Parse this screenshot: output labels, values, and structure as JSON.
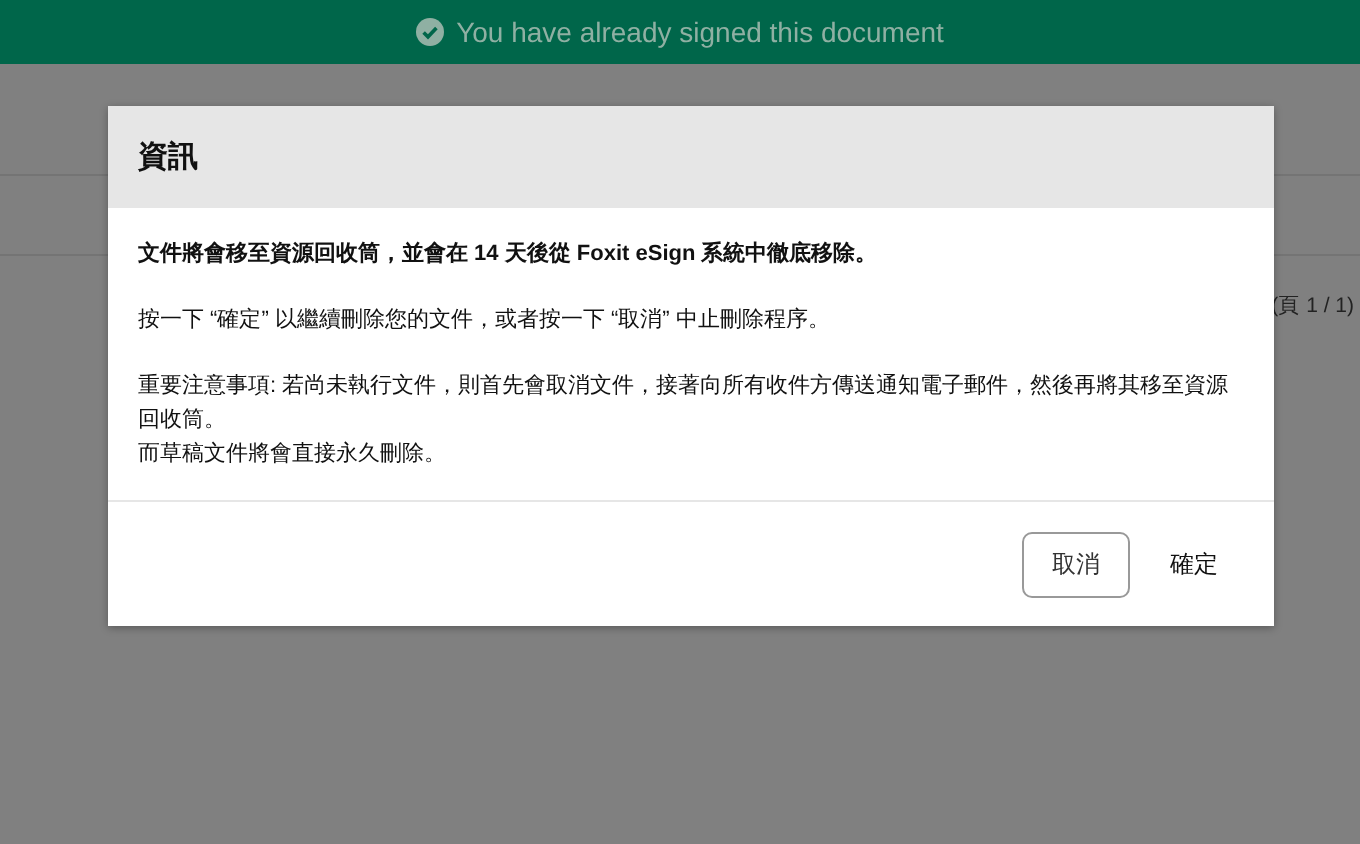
{
  "banner": {
    "text": "You have already signed this document"
  },
  "document": {
    "page_indicator": "(頁 1 / 1)"
  },
  "dialog": {
    "title": "資訊",
    "paragraphs": [
      {
        "bold": true,
        "lines": [
          "文件將會移至資源回收筒，並會在 14 天後從 Foxit eSign 系統中徹底移除。"
        ]
      },
      {
        "bold": false,
        "lines": [
          "按一下 “確定” 以繼續刪除您的文件，或者按一下 “取消” 中止刪除程序。"
        ]
      },
      {
        "bold": false,
        "lines": [
          "重要注意事項: 若尚未執行文件，則首先會取消文件，接著向所有收件方傳送通知電子郵件，然後再將其移至資源回收筒。",
          "而草稿文件將會直接永久刪除。"
        ]
      }
    ],
    "buttons": [
      {
        "label": "取消",
        "kind": "outlined"
      },
      {
        "label": "確定",
        "kind": "text"
      }
    ]
  }
}
